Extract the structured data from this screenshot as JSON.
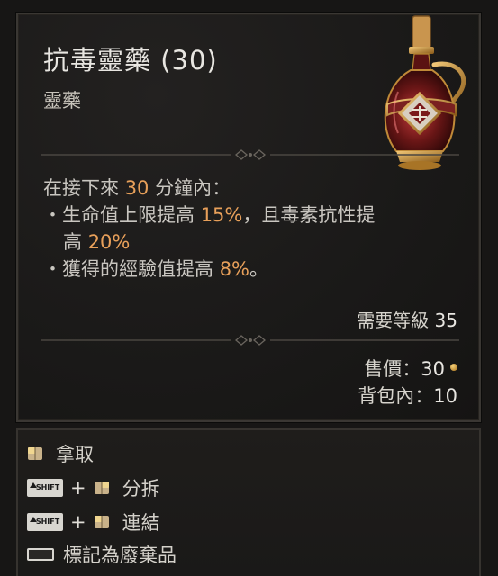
{
  "item": {
    "name": "抗毒靈藥 (30)",
    "type": "靈藥"
  },
  "description": {
    "intro_prefix": "在接下來 ",
    "intro_duration": "30",
    "intro_suffix": " 分鐘內：",
    "bullet1_prefix": "・生命值上限提高 ",
    "bullet1_value": "15%",
    "bullet1_mid": "，且毒素抗性提",
    "bullet1_cont_prefix": "高 ",
    "bullet1_cont_value": "20%",
    "bullet2_prefix": "・獲得的經驗值提高 ",
    "bullet2_value": "8%",
    "bullet2_suffix": "。"
  },
  "requirement": {
    "label": "需要等級 ",
    "level": "35"
  },
  "price": {
    "label": "售價：",
    "value": "30"
  },
  "stack": {
    "label": "背包內：",
    "value": "10"
  },
  "actions": {
    "pickup": "拿取",
    "split": "分拆",
    "link": "連結",
    "junk": "標記為廢棄品",
    "shift_key": "SHIFT",
    "plus": "+"
  },
  "colors": {
    "highlight": "#e8a05a",
    "text": "#c9c6c0",
    "panel": "#1a1918"
  },
  "icons": {
    "item": "elixir-bottle-icon",
    "currency": "gold-coin-icon",
    "mouse_left": "mouse-left-click-icon",
    "mouse_right": "mouse-right-click-icon"
  }
}
